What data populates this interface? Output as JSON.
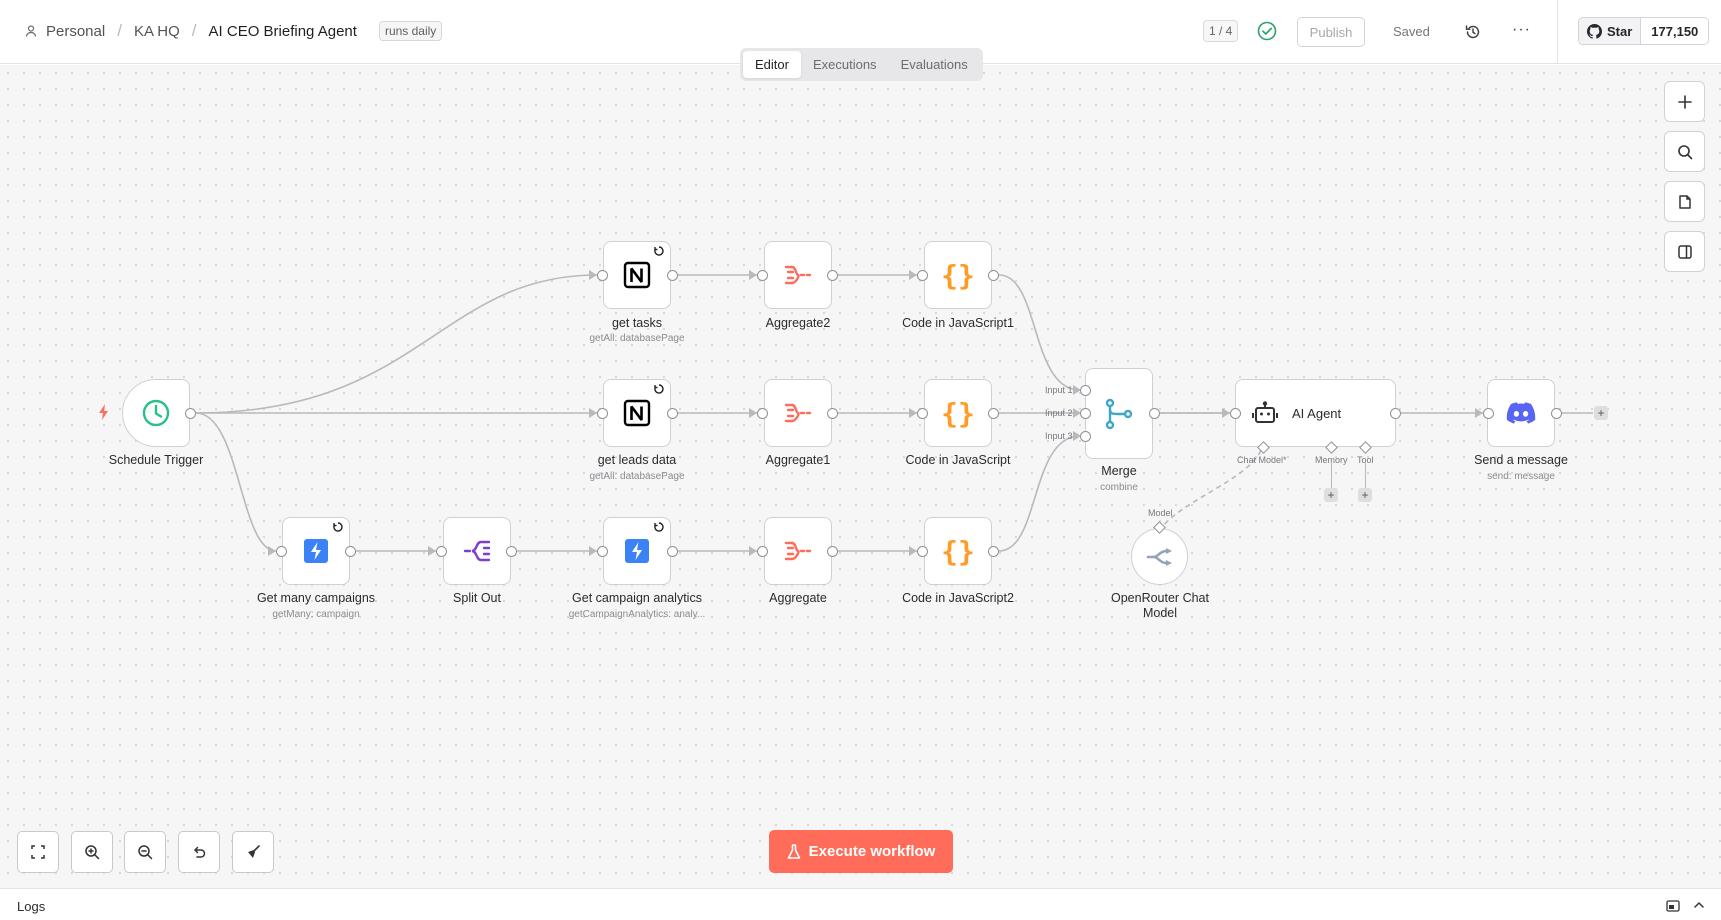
{
  "breadcrumb": {
    "personal": "Personal",
    "project": "KA HQ",
    "workflow": "AI CEO Briefing Agent"
  },
  "workflow_tag": "runs daily",
  "header": {
    "counter": "1 / 4",
    "publish": "Publish",
    "saved": "Saved",
    "more": "···"
  },
  "github": {
    "star_label": "Star",
    "star_count": "177,150"
  },
  "tabs": [
    {
      "label": "Editor"
    },
    {
      "label": "Executions"
    },
    {
      "label": "Evaluations"
    }
  ],
  "nodes": {
    "schedule_trigger": {
      "label": "Schedule Trigger"
    },
    "get_tasks": {
      "label": "get tasks",
      "sub": "getAll: databasePage"
    },
    "aggregate2": {
      "label": "Aggregate2"
    },
    "code_js1": {
      "label": "Code in JavaScript1"
    },
    "get_leads": {
      "label": "get leads data",
      "sub": "getAll: databasePage"
    },
    "aggregate1": {
      "label": "Aggregate1"
    },
    "code_js": {
      "label": "Code in JavaScript"
    },
    "get_campaigns": {
      "label": "Get many campaigns",
      "sub": "getMany: campaign"
    },
    "split_out": {
      "label": "Split Out"
    },
    "get_analytics": {
      "label": "Get campaign analytics",
      "sub": "getCampaignAnalytics: analy..."
    },
    "aggregate": {
      "label": "Aggregate"
    },
    "code_js2": {
      "label": "Code in JavaScript2"
    },
    "merge": {
      "label": "Merge",
      "sub": "combine",
      "inputs": [
        "Input 1",
        "Input 2",
        "Input 3"
      ]
    },
    "ai_agent": {
      "label": "AI Agent",
      "ports": {
        "chat_model": "Chat Model*",
        "memory": "Memory",
        "tool": "Tool"
      }
    },
    "openrouter": {
      "label_line1": "OpenRouter Chat",
      "label_line2": "Model",
      "port": "Model"
    },
    "discord": {
      "label": "Send a message",
      "sub": "send: message"
    }
  },
  "execute_button": "Execute workflow",
  "logs": {
    "label": "Logs"
  },
  "colors": {
    "accent": "#ff6d5a",
    "notion": "#000000",
    "aggregate": "#ff6d5a",
    "code": "#ff9b26",
    "split": "#7e3fcb",
    "merge": "#3fa7c5",
    "discord": "#5865f2",
    "instantly": "#3b82f6",
    "trigger": "#2bbf8a"
  }
}
